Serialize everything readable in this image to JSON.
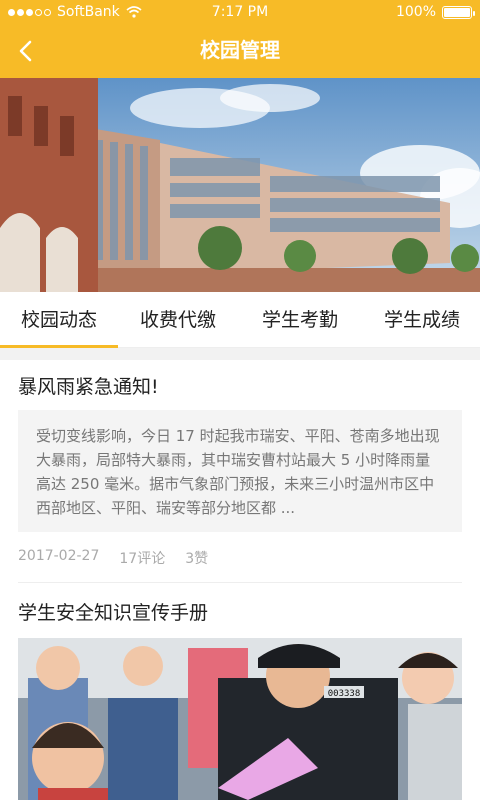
{
  "status_bar": {
    "carrier": "SoftBank",
    "time": "7:17 PM",
    "battery": "100%"
  },
  "nav": {
    "title": "校园管理",
    "back_icon": "chevron-left-icon"
  },
  "hero": {
    "image": "campus-building-photo"
  },
  "tabs": [
    {
      "label": "校园动态",
      "active": true
    },
    {
      "label": "收费代缴"
    },
    {
      "label": "学生考勤"
    },
    {
      "label": "学生成绩"
    }
  ],
  "articles": [
    {
      "title": "暴风雨紧急通知!",
      "summary": "受切变线影响，今日 17 时起我市瑞安、平阳、苍南多地出现大暴雨，局部特大暴雨，其中瑞安曹村站最大 5 小时降雨量高达 250 毫米。据市气象部门预报，未来三小时温州市区中西部地区、平阳、瑞安等部分地区都 ...",
      "date": "2017-02-27",
      "comments": "17评论",
      "likes": "3赞"
    },
    {
      "title": "学生安全知识宣传手册",
      "image": "safety-education-photo",
      "badge_number": "003338"
    }
  ],
  "colors": {
    "accent": "#f7bb27",
    "summary_bg": "#f4f4f4"
  }
}
